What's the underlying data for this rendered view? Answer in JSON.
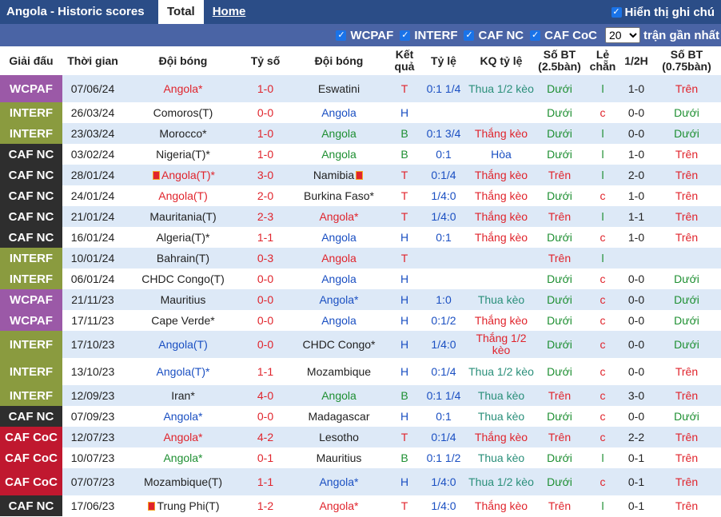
{
  "header": {
    "title": "Angola - Historic scores",
    "tab_total": "Total",
    "tab_home": "Home",
    "show_label": "Hiển thị ghi chú"
  },
  "filters": {
    "items": [
      "WCPAF",
      "INTERF",
      "CAF NC",
      "CAF CoC"
    ],
    "count": "20",
    "recent_label": "trận gần nhất"
  },
  "columns": [
    "Giải đấu",
    "Thời gian",
    "Đội bóng",
    "Tỷ số",
    "Đội bóng",
    "Kết quả",
    "Tỷ lệ",
    "KQ tỷ lệ",
    "Số BT (2.5bàn)",
    "Lẻ chẵn",
    "1/2H",
    "Số BT (0.75bàn)"
  ],
  "rows": [
    {
      "league": "WCPAF",
      "lc": "wcpaf",
      "date": "07/06/24",
      "home": "Angola*",
      "hc": "red",
      "score": "1-0",
      "away": "Eswatini",
      "ac": "",
      "res": "T",
      "odds": "0:1 1/4",
      "kq": "Thua 1/2 kèo",
      "kqc": "teal",
      "ou": "Dưới",
      "oe": "l",
      "ht": "1-0",
      "ou2": "Trên",
      "tall": true
    },
    {
      "league": "INTERF",
      "lc": "interf",
      "date": "26/03/24",
      "home": "Comoros(T)",
      "hc": "",
      "score": "0-0",
      "away": "Angola",
      "ac": "blue",
      "res": "H",
      "odds": "",
      "kq": "",
      "kqc": "",
      "ou": "Dưới",
      "oe": "c",
      "ht": "0-0",
      "ou2": "Dưới"
    },
    {
      "league": "INTERF",
      "lc": "interf",
      "date": "23/03/24",
      "home": "Morocco*",
      "hc": "",
      "score": "1-0",
      "away": "Angola",
      "ac": "green",
      "res": "B",
      "odds": "0:1 3/4",
      "kq": "Thắng kèo",
      "kqc": "red",
      "ou": "Dưới",
      "oe": "l",
      "ht": "0-0",
      "ou2": "Dưới"
    },
    {
      "league": "CAF NC",
      "lc": "cafnc",
      "date": "03/02/24",
      "home": "Nigeria(T)*",
      "hc": "",
      "score": "1-0",
      "away": "Angola",
      "ac": "green",
      "res": "B",
      "odds": "0:1",
      "kq": "Hòa",
      "kqc": "blue",
      "ou": "Dưới",
      "oe": "l",
      "ht": "1-0",
      "ou2": "Trên"
    },
    {
      "league": "CAF NC",
      "lc": "cafnc",
      "date": "28/01/24",
      "home": "Angola(T)*",
      "hc": "red",
      "hflag": true,
      "score": "3-0",
      "away": "Namibia",
      "ac": "",
      "aflag": true,
      "res": "T",
      "odds": "0:1/4",
      "kq": "Thắng kèo",
      "kqc": "red",
      "ou": "Trên",
      "oe": "l",
      "ht": "2-0",
      "ou2": "Trên"
    },
    {
      "league": "CAF NC",
      "lc": "cafnc",
      "date": "24/01/24",
      "home": "Angola(T)",
      "hc": "red",
      "score": "2-0",
      "away": "Burkina Faso*",
      "ac": "",
      "res": "T",
      "odds": "1/4:0",
      "kq": "Thắng kèo",
      "kqc": "red",
      "ou": "Dưới",
      "oe": "c",
      "ht": "1-0",
      "ou2": "Trên"
    },
    {
      "league": "CAF NC",
      "lc": "cafnc",
      "date": "21/01/24",
      "home": "Mauritania(T)",
      "hc": "",
      "score": "2-3",
      "away": "Angola*",
      "ac": "red",
      "res": "T",
      "odds": "1/4:0",
      "kq": "Thắng kèo",
      "kqc": "red",
      "ou": "Trên",
      "oe": "l",
      "ht": "1-1",
      "ou2": "Trên"
    },
    {
      "league": "CAF NC",
      "lc": "cafnc",
      "date": "16/01/24",
      "home": "Algeria(T)*",
      "hc": "",
      "score": "1-1",
      "away": "Angola",
      "ac": "blue",
      "res": "H",
      "odds": "0:1",
      "kq": "Thắng kèo",
      "kqc": "red",
      "ou": "Dưới",
      "oe": "c",
      "ht": "1-0",
      "ou2": "Trên"
    },
    {
      "league": "INTERF",
      "lc": "interf",
      "date": "10/01/24",
      "home": "Bahrain(T)",
      "hc": "",
      "score": "0-3",
      "away": "Angola",
      "ac": "red",
      "res": "T",
      "odds": "",
      "kq": "",
      "kqc": "",
      "ou": "Trên",
      "oe": "l",
      "ht": "",
      "ou2": ""
    },
    {
      "league": "INTERF",
      "lc": "interf",
      "date": "06/01/24",
      "home": "CHDC Congo(T)",
      "hc": "",
      "score": "0-0",
      "away": "Angola",
      "ac": "blue",
      "res": "H",
      "odds": "",
      "kq": "",
      "kqc": "",
      "ou": "Dưới",
      "oe": "c",
      "ht": "0-0",
      "ou2": "Dưới"
    },
    {
      "league": "WCPAF",
      "lc": "wcpaf",
      "date": "21/11/23",
      "home": "Mauritius",
      "hc": "",
      "score": "0-0",
      "away": "Angola*",
      "ac": "blue",
      "res": "H",
      "odds": "1:0",
      "kq": "Thua kèo",
      "kqc": "teal",
      "ou": "Dưới",
      "oe": "c",
      "ht": "0-0",
      "ou2": "Dưới"
    },
    {
      "league": "WCPAF",
      "lc": "wcpaf",
      "date": "17/11/23",
      "home": "Cape Verde*",
      "hc": "",
      "score": "0-0",
      "away": "Angola",
      "ac": "blue",
      "res": "H",
      "odds": "0:1/2",
      "kq": "Thắng kèo",
      "kqc": "red",
      "ou": "Dưới",
      "oe": "c",
      "ht": "0-0",
      "ou2": "Dưới"
    },
    {
      "league": "INTERF",
      "lc": "interf",
      "date": "17/10/23",
      "home": "Angola(T)",
      "hc": "blue",
      "score": "0-0",
      "away": "CHDC Congo*",
      "ac": "",
      "res": "H",
      "odds": "1/4:0",
      "kq": "Thắng 1/2 kèo",
      "kqc": "red",
      "ou": "Dưới",
      "oe": "c",
      "ht": "0-0",
      "ou2": "Dưới",
      "tall": true
    },
    {
      "league": "INTERF",
      "lc": "interf",
      "date": "13/10/23",
      "home": "Angola(T)*",
      "hc": "blue",
      "score": "1-1",
      "away": "Mozambique",
      "ac": "",
      "res": "H",
      "odds": "0:1/4",
      "kq": "Thua 1/2 kèo",
      "kqc": "teal",
      "ou": "Dưới",
      "oe": "c",
      "ht": "0-0",
      "ou2": "Trên",
      "tall": true
    },
    {
      "league": "INTERF",
      "lc": "interf",
      "date": "12/09/23",
      "home": "Iran*",
      "hc": "",
      "score": "4-0",
      "away": "Angola",
      "ac": "green",
      "res": "B",
      "odds": "0:1 1/4",
      "kq": "Thua kèo",
      "kqc": "teal",
      "ou": "Trên",
      "oe": "c",
      "ht": "3-0",
      "ou2": "Trên"
    },
    {
      "league": "CAF NC",
      "lc": "cafnc",
      "date": "07/09/23",
      "home": "Angola*",
      "hc": "blue",
      "score": "0-0",
      "away": "Madagascar",
      "ac": "",
      "res": "H",
      "odds": "0:1",
      "kq": "Thua kèo",
      "kqc": "teal",
      "ou": "Dưới",
      "oe": "c",
      "ht": "0-0",
      "ou2": "Dưới"
    },
    {
      "league": "CAF CoC",
      "lc": "cafcoc",
      "date": "12/07/23",
      "home": "Angola*",
      "hc": "red",
      "score": "4-2",
      "away": "Lesotho",
      "ac": "",
      "res": "T",
      "odds": "0:1/4",
      "kq": "Thắng kèo",
      "kqc": "red",
      "ou": "Trên",
      "oe": "c",
      "ht": "2-2",
      "ou2": "Trên"
    },
    {
      "league": "CAF CoC",
      "lc": "cafcoc",
      "date": "10/07/23",
      "home": "Angola*",
      "hc": "green",
      "score": "0-1",
      "away": "Mauritius",
      "ac": "",
      "res": "B",
      "odds": "0:1 1/2",
      "kq": "Thua kèo",
      "kqc": "teal",
      "ou": "Dưới",
      "oe": "l",
      "ht": "0-1",
      "ou2": "Trên"
    },
    {
      "league": "CAF CoC",
      "lc": "cafcoc",
      "date": "07/07/23",
      "home": "Mozambique(T)",
      "hc": "",
      "score": "1-1",
      "away": "Angola*",
      "ac": "blue",
      "res": "H",
      "odds": "1/4:0",
      "kq": "Thua 1/2 kèo",
      "kqc": "teal",
      "ou": "Dưới",
      "oe": "c",
      "ht": "0-1",
      "ou2": "Trên",
      "tall": true
    },
    {
      "league": "CAF NC",
      "lc": "cafnc",
      "date": "17/06/23",
      "home": "Trung Phi(T)",
      "hc": "",
      "hflag": true,
      "score": "1-2",
      "away": "Angola*",
      "ac": "red",
      "res": "T",
      "odds": "1/4:0",
      "kq": "Thắng kèo",
      "kqc": "red",
      "ou": "Trên",
      "oe": "l",
      "ht": "0-1",
      "ou2": "Trên"
    }
  ]
}
